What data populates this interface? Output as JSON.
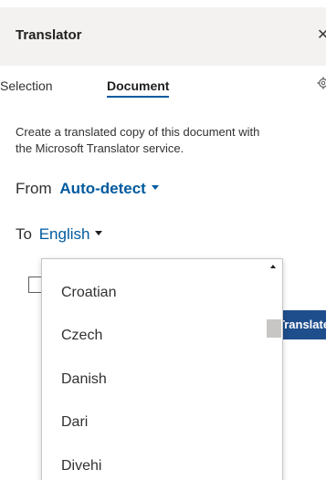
{
  "header": {
    "title": "Translator",
    "close_icon": "close-icon"
  },
  "tabs": [
    {
      "label": "Selection",
      "active": false
    },
    {
      "label": "Document",
      "active": true
    }
  ],
  "settings_icon": "gear-icon",
  "description": {
    "line1": "Create a translated copy of this document with",
    "line2": "the Microsoft Translator service."
  },
  "from": {
    "label": "From",
    "value": "Auto-detect"
  },
  "to": {
    "label": "To",
    "value": "English"
  },
  "translate_button": {
    "label": "Translate"
  },
  "dropdown": {
    "options": [
      "Croatian",
      "Czech",
      "Danish",
      "Dari",
      "Divehi"
    ]
  },
  "colors": {
    "accent": "#005a9e",
    "header_bg": "#f3f2f1",
    "button_bg": "#1f4e8c"
  }
}
